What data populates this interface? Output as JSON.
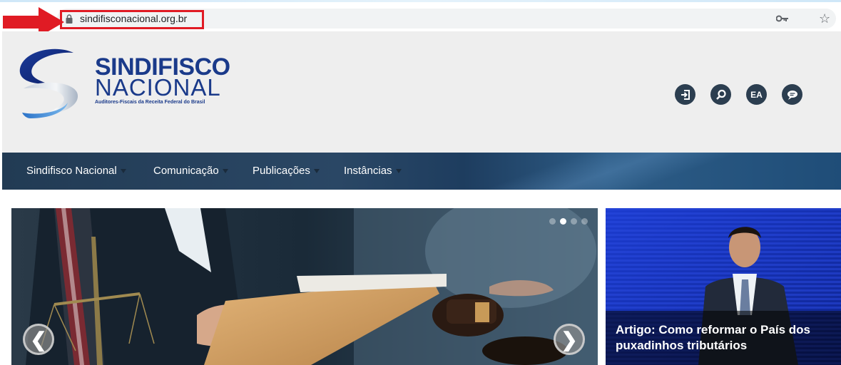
{
  "browser": {
    "url": "sindifisconacional.org.br"
  },
  "brand": {
    "name_line1": "SINDIFISCO",
    "name_line2": "NACIONAL",
    "tagline": "Auditores-Fiscais da Receita Federal do Brasil"
  },
  "header_icons": {
    "login": "login-icon",
    "search": "search-icon",
    "ea": "EA",
    "chat": "chat-icon"
  },
  "nav": {
    "items": [
      {
        "label": "Sindifisco Nacional"
      },
      {
        "label": "Comunicação"
      },
      {
        "label": "Publicações"
      },
      {
        "label": "Instâncias"
      }
    ]
  },
  "hero": {
    "prev": "❮",
    "next": "❯",
    "slides_total": 4,
    "active_slide": 2
  },
  "side_card": {
    "title": "Artigo: Como reformar o País dos puxadinhos tributários"
  },
  "colors": {
    "annotation_red": "#e01b24",
    "brand_blue": "#1a3a8a",
    "nav_dark": "#223b54",
    "icon_dark": "#2c3e50"
  }
}
